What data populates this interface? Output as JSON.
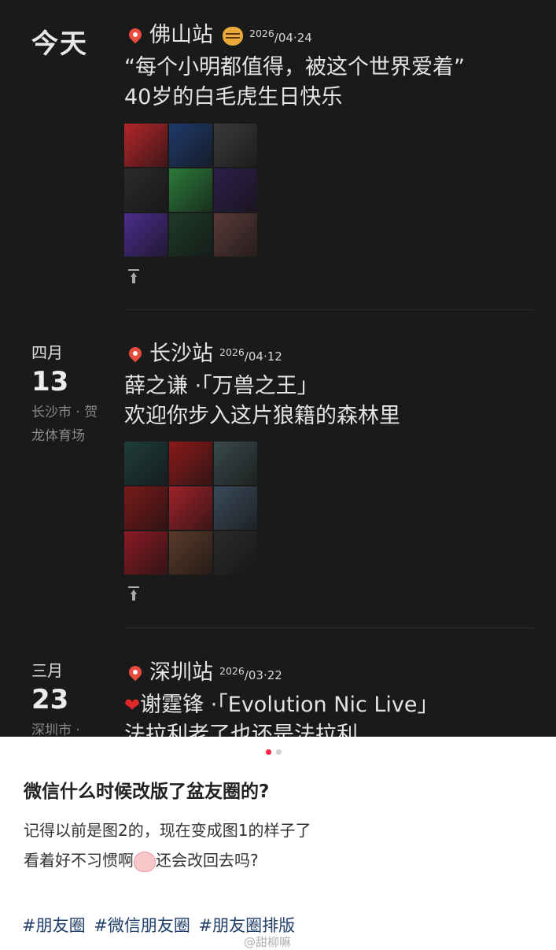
{
  "posts": [
    {
      "date_label": "今天",
      "station": "佛山站",
      "date_year": "2026",
      "date_rest": "/04·24",
      "lines": [
        "“每个小明都值得，被这个世界爱着”",
        "40岁的白毛虎生日快乐"
      ],
      "photo_colors": [
        "#b3262a",
        "#1f3a6b",
        "#3a3a3a",
        "#2b2b2b",
        "#2c7a3a",
        "#2d1f4a",
        "#4b2c8c",
        "#1e3a2a",
        "#5a3a3a"
      ]
    },
    {
      "month": "四月",
      "day": "13",
      "location": "长沙市 · 贺龙体育场",
      "station": "长沙站",
      "date_year": "2026",
      "date_rest": "/04·12",
      "lines": [
        "薛之谦 ·「万兽之王」",
        "欢迎你步入这片狼籍的森林里"
      ],
      "photo_colors": [
        "#1f3d3a",
        "#8a1a1a",
        "#3a4a4a",
        "#7a1a1a",
        "#a0222a",
        "#3a4a5a",
        "#8a1b24",
        "#5a3a2a",
        "#2a2a2a"
      ]
    },
    {
      "month": "三月",
      "day": "23",
      "location": "深圳市 ·",
      "station": "深圳站",
      "date_year": "2026",
      "date_rest": "/03·22",
      "lines": [
        "谢霆锋 ·「Evolution Nic Live」",
        "法拉利老了也还是法拉利"
      ]
    }
  ],
  "card": {
    "title": "微信什么时候改版了盆友圈的?",
    "body_line1": "记得以前是图2的，现在变成图1的样子了",
    "body_line2a": "看着好不习惯啊",
    "body_line2b": "还会改回去吗?",
    "tags": "#朋友圈 #微信朋友圈 #朋友圈排版",
    "watermark": "@甜柳嘛",
    "carousel_active": 0
  }
}
